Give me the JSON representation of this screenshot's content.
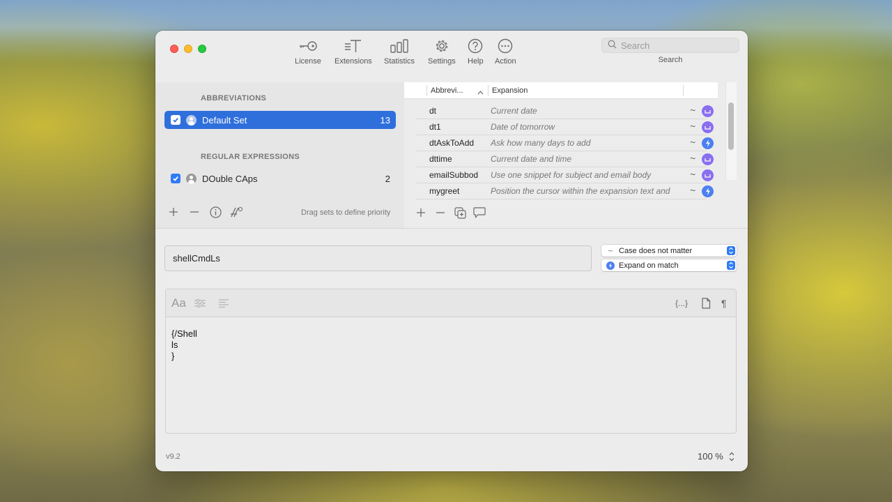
{
  "toolbar": {
    "items": [
      {
        "label": "License",
        "icon": "key-icon"
      },
      {
        "label": "Extensions",
        "icon": "extensions-icon"
      },
      {
        "label": "Statistics",
        "icon": "statistics-icon"
      },
      {
        "label": "Settings",
        "icon": "gear-icon"
      },
      {
        "label": "Help",
        "icon": "help-icon"
      },
      {
        "label": "Action",
        "icon": "ellipsis-icon"
      }
    ],
    "search_placeholder": "Search",
    "search_label": "Search"
  },
  "sidebar": {
    "abbreviations_header": "ABBREVIATIONS",
    "regex_header": "REGULAR EXPRESSIONS",
    "sets": [
      {
        "name": "Default Set",
        "count": "13",
        "checked": true,
        "selected": true
      },
      {
        "name": "DOuble CAps",
        "count": "2",
        "checked": true,
        "selected": false
      }
    ],
    "drag_hint": "Drag sets to define priority"
  },
  "table": {
    "columns": [
      "Abbrevi...",
      "Expansion"
    ],
    "rows": [
      {
        "abbr": "dt",
        "expansion": "Current date",
        "mode": "~",
        "trigger": "space"
      },
      {
        "abbr": "dt1",
        "expansion": "Date of tomorrow",
        "mode": "~",
        "trigger": "space"
      },
      {
        "abbr": "dtAskToAdd",
        "expansion": "Ask how many days to add",
        "mode": "~",
        "trigger": "bolt"
      },
      {
        "abbr": "dttime",
        "expansion": "Current date and time",
        "mode": "~",
        "trigger": "space"
      },
      {
        "abbr": "emailSubbod",
        "expansion": "Use one snippet for subject and email body",
        "mode": "~",
        "trigger": "space"
      },
      {
        "abbr": "mygreet",
        "expansion": "Position the cursor within the expansion text and",
        "mode": "~",
        "trigger": "bolt"
      }
    ]
  },
  "editor": {
    "abbreviation_value": "shellCmdLs",
    "case_option": "Case does not matter",
    "expand_option": "Expand on match",
    "content": "{/Shell\nls\n}",
    "format_label": "Aa",
    "placeholder_button": "{...}"
  },
  "footer": {
    "version": "v9.2",
    "zoom": "100 %"
  },
  "colors": {
    "selection": "#2f6fdc",
    "badge_space": "#8a6ef0",
    "badge_bolt": "#4c7ff0",
    "checkbox": "#2f7bf5"
  }
}
